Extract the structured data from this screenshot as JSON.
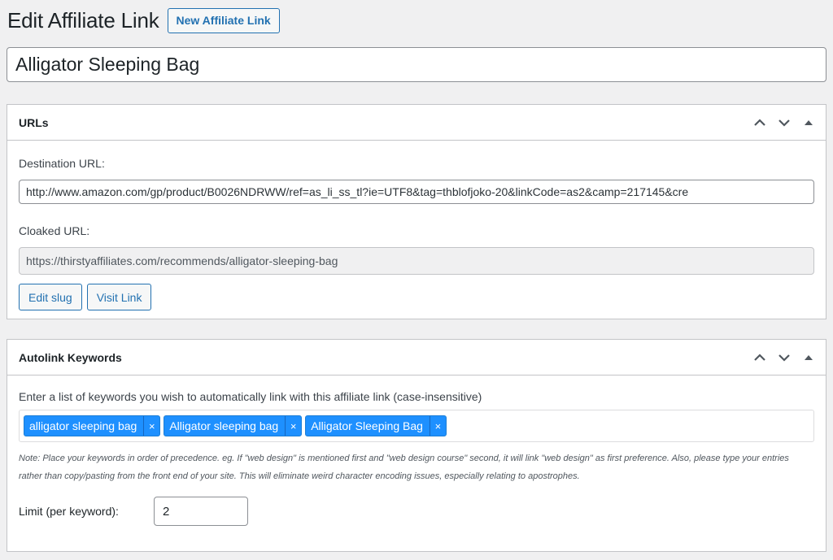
{
  "header": {
    "title": "Edit Affiliate Link",
    "new_button_label": "New Affiliate Link"
  },
  "post_title": "Alligator Sleeping Bag",
  "urls_box": {
    "title": "URLs",
    "destination_label": "Destination URL:",
    "destination_value": "http://www.amazon.com/gp/product/B0026NDRWW/ref=as_li_ss_tl?ie=UTF8&tag=thblofjoko-20&linkCode=as2&camp=217145&cre",
    "cloaked_label": "Cloaked URL:",
    "cloaked_value": "https://thirstyaffiliates.com/recommends/alligator-sleeping-bag",
    "edit_slug_label": "Edit slug",
    "visit_link_label": "Visit Link"
  },
  "autolink_box": {
    "title": "Autolink Keywords",
    "instructions": "Enter a list of keywords you wish to automatically link with this affiliate link (case-insensitive)",
    "keywords": [
      "alligator sleeping bag",
      "Alligator sleeping bag",
      "Alligator Sleeping Bag"
    ],
    "remove_glyph": "×",
    "note_line1": "Note: Place your keywords in order of precedence. eg. If \"web design\" is mentioned first and \"web design course\" second, it will link \"web design\" as first preference. Also, please type your entries",
    "note_line2": "rather than copy/pasting from the front end of your site. This will eliminate weird character encoding issues, especially relating to apostrophes.",
    "limit_label": "Limit (per keyword):",
    "limit_value": "2"
  },
  "icons": {
    "move_up": "chevron-up-icon",
    "move_down": "chevron-down-icon",
    "toggle": "triangle-up-icon"
  },
  "colors": {
    "accent": "#2271b1",
    "tag_bg": "#1e90ff",
    "page_bg": "#f0f0f1"
  }
}
